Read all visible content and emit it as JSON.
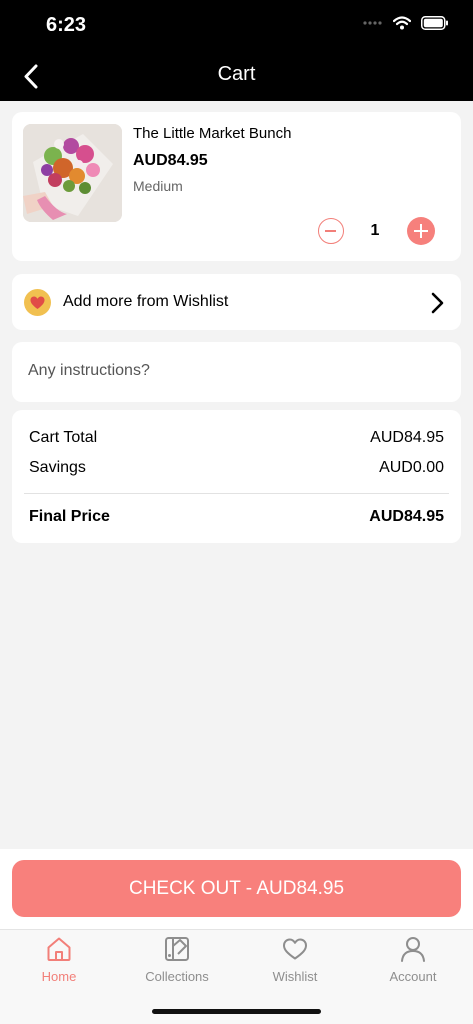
{
  "status_bar": {
    "time": "6:23"
  },
  "header": {
    "title": "Cart"
  },
  "cart_item": {
    "name": "The Little Market Bunch",
    "price": "AUD84.95",
    "size": "Medium",
    "quantity": "1",
    "image_description": "bouquet of wildflowers wrapped in paper"
  },
  "wishlist": {
    "label": "Add more from Wishlist"
  },
  "instructions": {
    "placeholder": "Any instructions?",
    "value": ""
  },
  "summary": {
    "cart_total_label": "Cart Total",
    "cart_total_value": "AUD84.95",
    "savings_label": "Savings",
    "savings_value": "AUD0.00",
    "final_label": "Final Price",
    "final_value": "AUD84.95"
  },
  "checkout": {
    "label": "CHECK OUT - AUD84.95"
  },
  "tabs": [
    {
      "label": "Home",
      "icon": "home-icon",
      "active": true
    },
    {
      "label": "Collections",
      "icon": "collections-icon",
      "active": false
    },
    {
      "label": "Wishlist",
      "icon": "heart-icon",
      "active": false
    },
    {
      "label": "Account",
      "icon": "user-icon",
      "active": false
    }
  ],
  "colors": {
    "accent": "#f8807c",
    "header": "#000000",
    "background": "#f3f3f3"
  }
}
